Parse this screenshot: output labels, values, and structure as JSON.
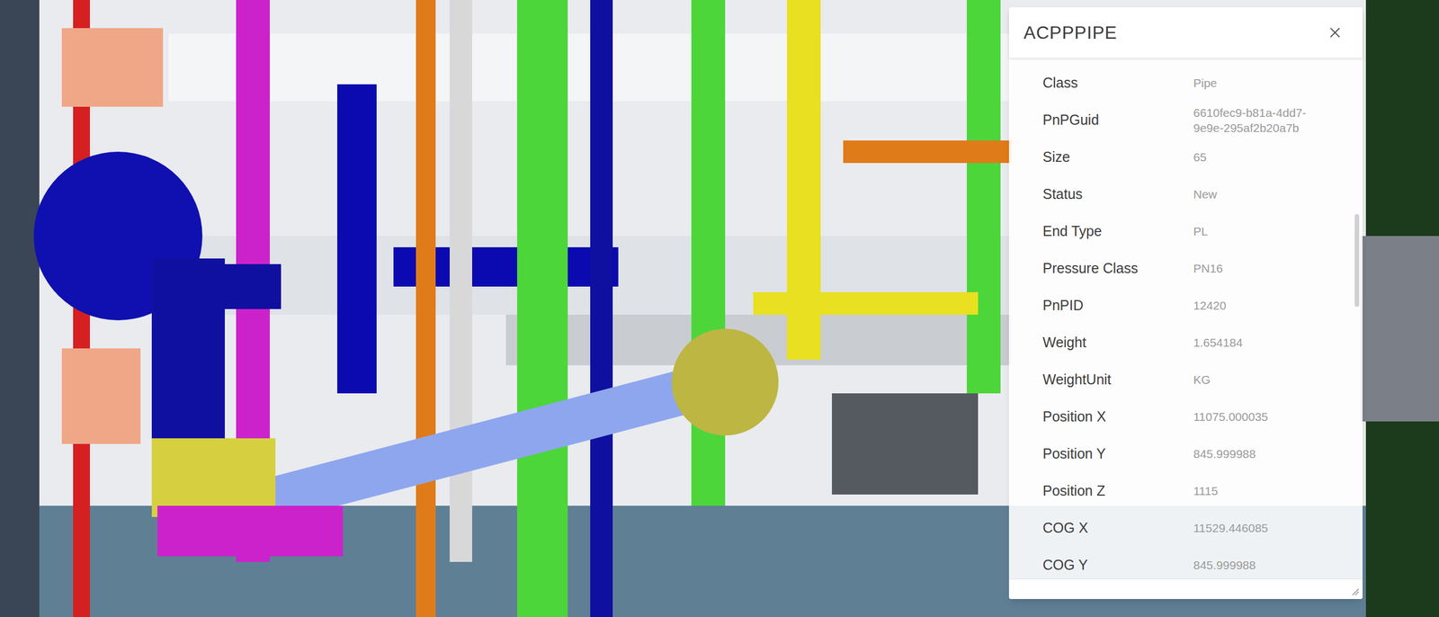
{
  "panel": {
    "title": "ACPPPIPE",
    "properties": [
      {
        "label": "Class",
        "value": "Pipe"
      },
      {
        "label": "PnPGuid",
        "value": "6610fec9-b81a-4dd7-9e9e-295af2b20a7b"
      },
      {
        "label": "Size",
        "value": "65"
      },
      {
        "label": "Status",
        "value": "New"
      },
      {
        "label": "End Type",
        "value": "PL"
      },
      {
        "label": "Pressure Class",
        "value": "PN16"
      },
      {
        "label": "PnPID",
        "value": "12420"
      },
      {
        "label": "Weight",
        "value": "1.654184"
      },
      {
        "label": "WeightUnit",
        "value": "KG"
      },
      {
        "label": "Position X",
        "value": "11075.000035"
      },
      {
        "label": "Position Y",
        "value": "845.999988"
      },
      {
        "label": "Position Z",
        "value": "1115"
      },
      {
        "label": "COG X",
        "value": "11529.446085"
      },
      {
        "label": "COG Y",
        "value": "845.999988"
      }
    ],
    "scrollbar": {
      "level": 0.3
    }
  }
}
